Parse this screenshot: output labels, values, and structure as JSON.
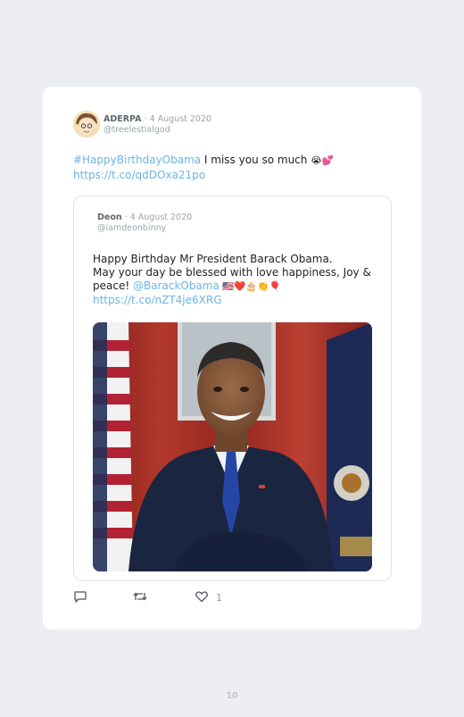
{
  "tweet": {
    "display_name": "ADERPA",
    "separator": " · ",
    "date": "4 August 2020",
    "handle": "@treelestialgod",
    "hashtag": "#HappyBirthdayObama",
    "text": " I miss you so much ",
    "emoji": "😭💕",
    "link": "https://t.co/qdDOxa21po",
    "like_count": "1"
  },
  "quoted": {
    "display_name": "Deon",
    "separator": " · ",
    "date": "4 August 2020",
    "handle": "@iamdeonbinny",
    "line1": "Happy Birthday Mr President Barack Obama.",
    "line2": "May your day be blessed with love happiness, Joy &",
    "line3_prefix": "peace! ",
    "mention": "@BarackObama",
    "emoji": " 🇺🇸❤️🎂👏🎈",
    "link": "https://t.co/nZT4je6XRG"
  },
  "page": {
    "number": "10"
  },
  "icons": {
    "reply": "reply-icon",
    "retweet": "retweet-icon",
    "like": "heart-icon"
  },
  "colors": {
    "link": "#6ab4e6",
    "meta": "#9aa4ad",
    "page_bg": "#eceef1"
  }
}
